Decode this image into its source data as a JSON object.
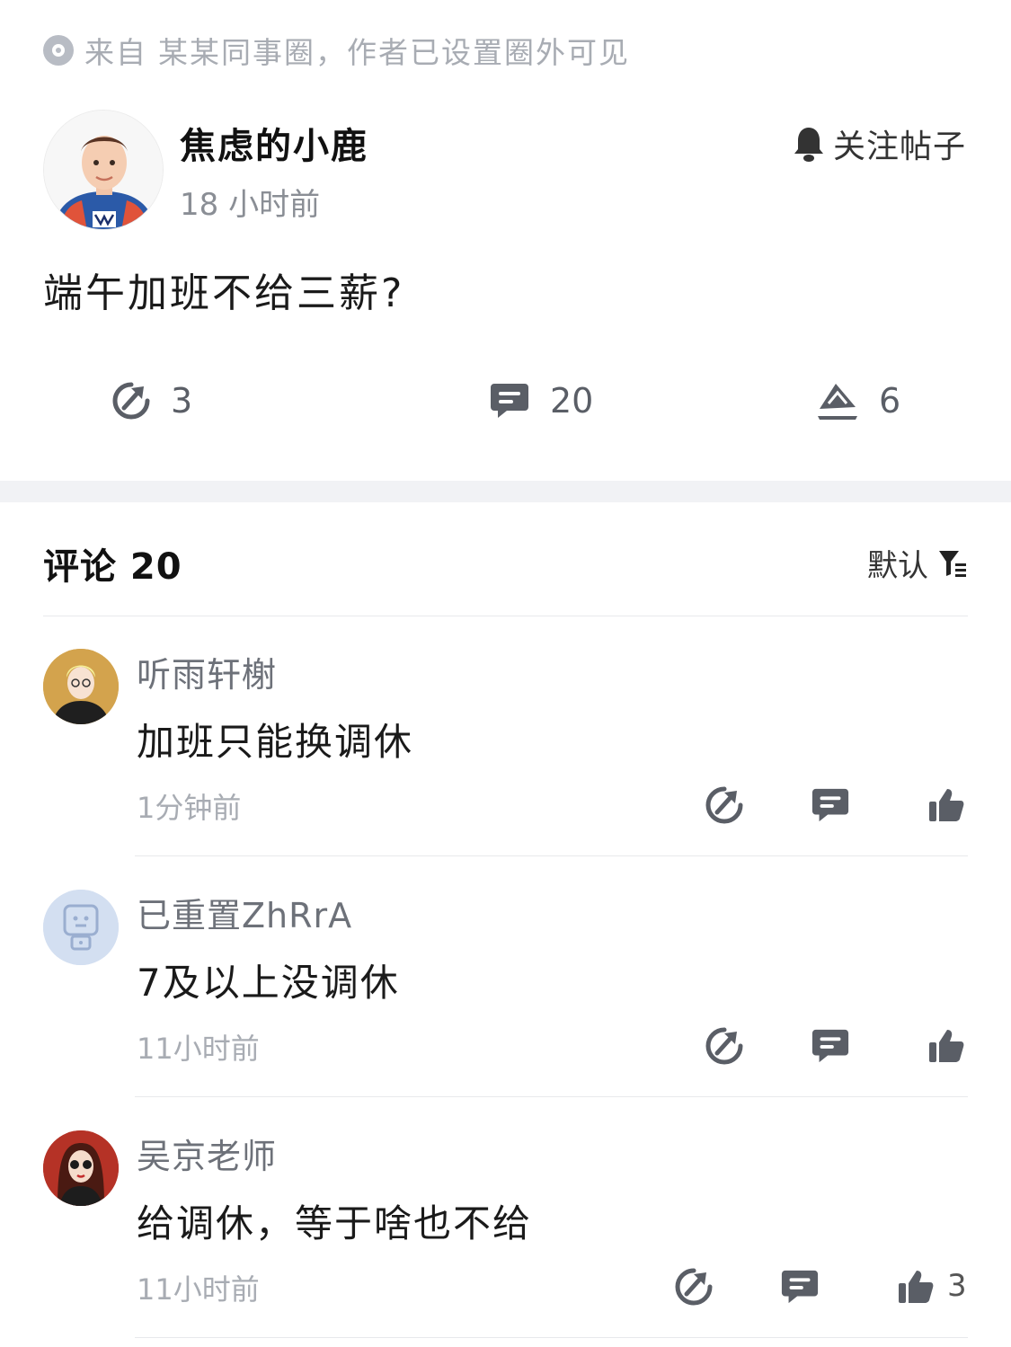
{
  "source": {
    "prefix": "来自",
    "circle": "某某同事圈，作者已设置圈外可见"
  },
  "post": {
    "author": "焦虑的小鹿",
    "time": "18 小时前",
    "follow_label": "关注帖子",
    "text": "端午加班不给三薪?",
    "forward_count": "3",
    "comment_count": "20",
    "like_count": "6"
  },
  "comments_header": {
    "title": "评论 20",
    "sort_label": "默认"
  },
  "comments": [
    {
      "name": "听雨轩榭",
      "text": "加班只能换调休",
      "time": "1分钟前",
      "likes": ""
    },
    {
      "name": "已重置ZhRrA",
      "text": "7及以上没调休",
      "time": "11小时前",
      "likes": ""
    },
    {
      "name": "吴京老师",
      "text": "给调休，等于啥也不给",
      "time": "11小时前",
      "likes": "3"
    }
  ],
  "icons": [
    "info-dot-icon",
    "bell-icon",
    "forward-icon",
    "comment-icon",
    "pin-like-icon",
    "filter-icon",
    "thumb-up-icon"
  ],
  "colors": {
    "muted": "#a8acb3",
    "icon": "#5a5e66",
    "band": "#f1f2f5"
  }
}
